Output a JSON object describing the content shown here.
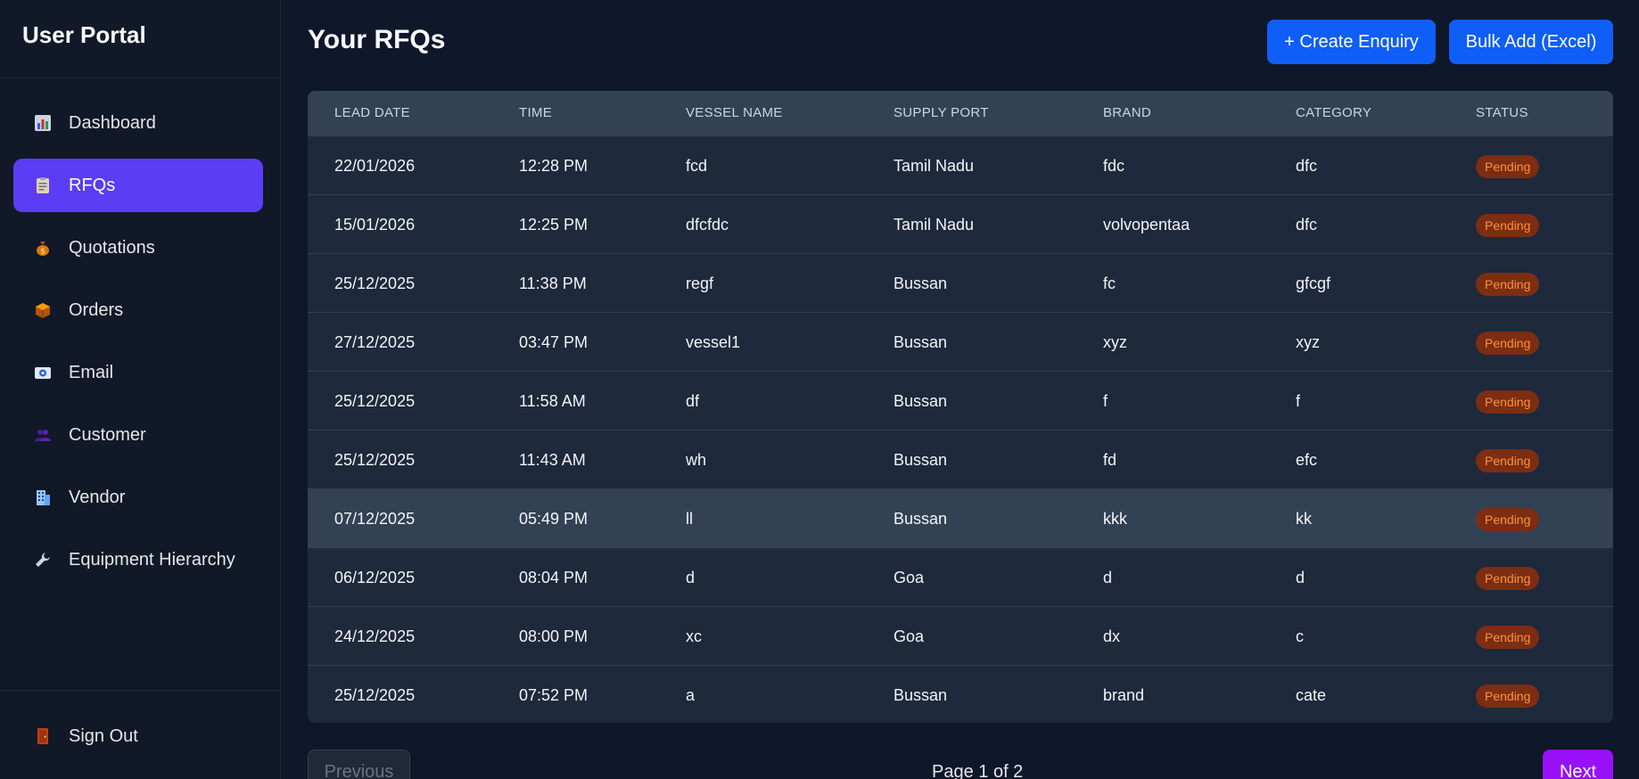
{
  "sidebar": {
    "title": "User Portal",
    "items": [
      {
        "label": "Dashboard",
        "icon": "bar-chart-icon",
        "active": false
      },
      {
        "label": "RFQs",
        "icon": "clipboard-icon",
        "active": true
      },
      {
        "label": "Quotations",
        "icon": "money-bag-icon",
        "active": false
      },
      {
        "label": "Orders",
        "icon": "package-icon",
        "active": false
      },
      {
        "label": "Email",
        "icon": "email-icon",
        "active": false
      },
      {
        "label": "Customer",
        "icon": "users-icon",
        "active": false
      },
      {
        "label": "Vendor",
        "icon": "building-icon",
        "active": false
      },
      {
        "label": "Equipment Hierarchy",
        "icon": "wrench-icon",
        "active": false
      }
    ],
    "signout": {
      "label": "Sign Out",
      "icon": "door-icon"
    }
  },
  "header": {
    "title": "Your RFQs",
    "create_label": "+ Create Enquiry",
    "bulk_label": "Bulk Add (Excel)"
  },
  "table": {
    "columns": [
      "LEAD DATE",
      "TIME",
      "VESSEL NAME",
      "SUPPLY PORT",
      "BRAND",
      "CATEGORY",
      "STATUS"
    ],
    "rows": [
      [
        "22/01/2026",
        "12:28 PM",
        "fcd",
        "Tamil Nadu",
        "fdc",
        "dfc",
        "Pending"
      ],
      [
        "15/01/2026",
        "12:25 PM",
        "dfcfdc",
        "Tamil Nadu",
        "volvopentaa",
        "dfc",
        "Pending"
      ],
      [
        "25/12/2025",
        "11:38 PM",
        "regf",
        "Bussan",
        "fc",
        "gfcgf",
        "Pending"
      ],
      [
        "27/12/2025",
        "03:47 PM",
        "vessel1",
        "Bussan",
        "xyz",
        "xyz",
        "Pending"
      ],
      [
        "25/12/2025",
        "11:58 AM",
        "df",
        "Bussan",
        "f",
        "f",
        "Pending"
      ],
      [
        "25/12/2025",
        "11:43 AM",
        "wh",
        "Bussan",
        "fd",
        "efc",
        "Pending"
      ],
      [
        "07/12/2025",
        "05:49 PM",
        "ll",
        "Bussan",
        "kkk",
        "kk",
        "Pending"
      ],
      [
        "06/12/2025",
        "08:04 PM",
        "d",
        "Goa",
        "d",
        "d",
        "Pending"
      ],
      [
        "24/12/2025",
        "08:00 PM",
        "xc",
        "Goa",
        "dx",
        "c",
        "Pending"
      ],
      [
        "25/12/2025",
        "07:52 PM",
        "a",
        "Bussan",
        "brand",
        "cate",
        "Pending"
      ]
    ]
  },
  "pagination": {
    "prev_label": "Previous",
    "page_info": "Page 1 of 2",
    "next_label": "Next"
  },
  "colors": {
    "accent": "#5b3df5",
    "primary_button": "#0f5ef7",
    "next_button": "#9810fa",
    "pending_badge_bg": "#7c2d12",
    "pending_badge_text": "#fb923c"
  }
}
